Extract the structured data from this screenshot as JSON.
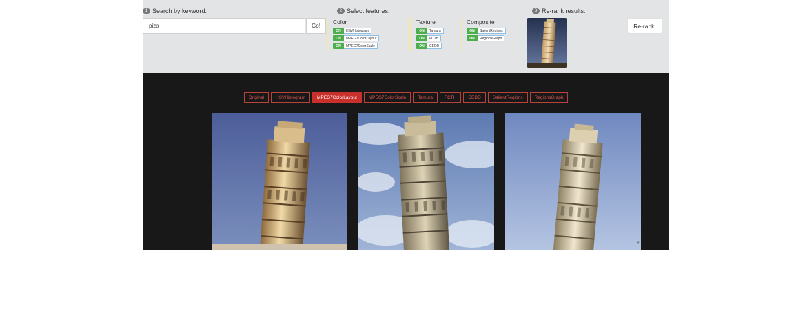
{
  "search": {
    "step_number": "1",
    "label": "Search by keyword:",
    "value": "piza",
    "go_label": "Go!"
  },
  "features": {
    "step_number": "2",
    "label": "Select features:",
    "toggle_state": "ON",
    "groups": [
      {
        "title": "Color",
        "items": [
          "HSVHistogram",
          "MPEG7ColorLayout",
          "MPEG7ColorScale"
        ]
      },
      {
        "title": "Texture",
        "items": [
          "Tamura",
          "FCTH",
          "CEDD"
        ]
      },
      {
        "title": "Composite",
        "items": [
          "SalientRegions",
          "RegionsGraph"
        ]
      }
    ]
  },
  "rerank": {
    "step_number": "3",
    "label": "Re-rank results:",
    "button_label": "Re-rank!"
  },
  "result_tabs": [
    "Original",
    "HSVHistogram",
    "MPEG7ColorLayout",
    "MPEG7ColorScale",
    "Tamura",
    "FCTH",
    "CEDD",
    "SalientRegions",
    "RegionsGraph"
  ],
  "active_tab": "MPEG7ColorLayout",
  "results": [
    "leaning-tower-photo",
    "leaning-tower-photo",
    "leaning-tower-photo"
  ],
  "caret_glyph": "▼",
  "colors": {
    "panel_bg": "#e3e4e5",
    "results_bg": "#181818",
    "accent_red": "#c9302c",
    "toggle_green": "#4cae4c"
  }
}
